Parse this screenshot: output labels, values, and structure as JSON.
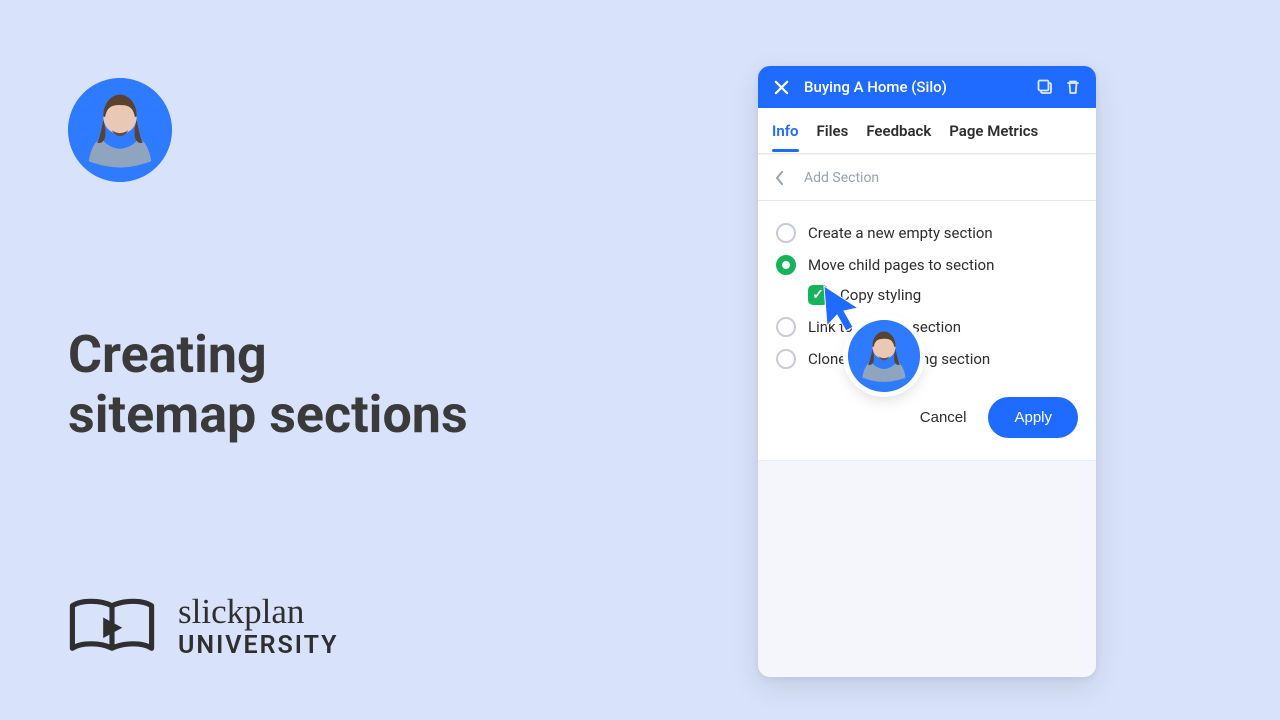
{
  "heading_line1": "Creating",
  "heading_line2": "sitemap sections",
  "brand": {
    "script": "slickplan",
    "university": "UNIVERSITY"
  },
  "panel": {
    "title": "Buying A Home (Silo)",
    "tabs": [
      "Info",
      "Files",
      "Feedback",
      "Page Metrics"
    ],
    "active_tab_index": 0,
    "subheader_label": "Add Section",
    "options": {
      "create_empty": "Create a new empty section",
      "move_children": "Move child pages to section",
      "copy_styling": "Copy styling",
      "link_existing": "Link to existing section",
      "clone_existing": "Clone from existing section"
    },
    "actions": {
      "cancel": "Cancel",
      "apply": "Apply"
    }
  }
}
